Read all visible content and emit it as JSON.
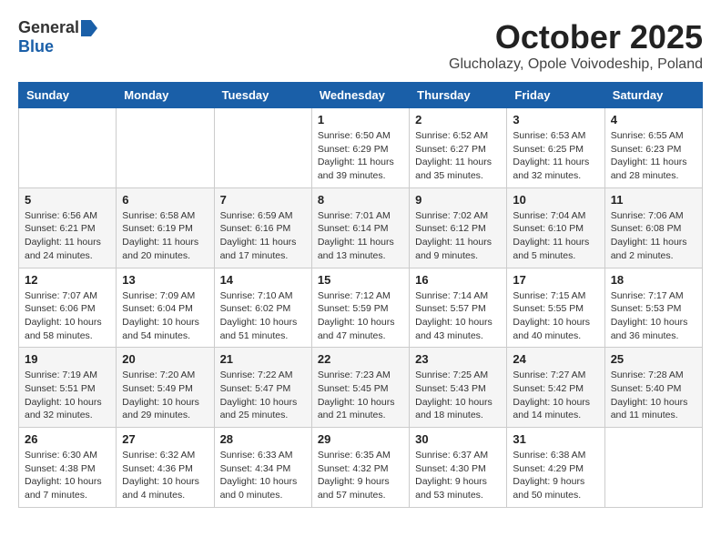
{
  "logo": {
    "general": "General",
    "blue": "Blue"
  },
  "title": {
    "month": "October 2025",
    "location": "Glucholazy, Opole Voivodeship, Poland"
  },
  "headers": [
    "Sunday",
    "Monday",
    "Tuesday",
    "Wednesday",
    "Thursday",
    "Friday",
    "Saturday"
  ],
  "weeks": [
    [
      {
        "day": "",
        "info": ""
      },
      {
        "day": "",
        "info": ""
      },
      {
        "day": "",
        "info": ""
      },
      {
        "day": "1",
        "info": "Sunrise: 6:50 AM\nSunset: 6:29 PM\nDaylight: 11 hours\nand 39 minutes."
      },
      {
        "day": "2",
        "info": "Sunrise: 6:52 AM\nSunset: 6:27 PM\nDaylight: 11 hours\nand 35 minutes."
      },
      {
        "day": "3",
        "info": "Sunrise: 6:53 AM\nSunset: 6:25 PM\nDaylight: 11 hours\nand 32 minutes."
      },
      {
        "day": "4",
        "info": "Sunrise: 6:55 AM\nSunset: 6:23 PM\nDaylight: 11 hours\nand 28 minutes."
      }
    ],
    [
      {
        "day": "5",
        "info": "Sunrise: 6:56 AM\nSunset: 6:21 PM\nDaylight: 11 hours\nand 24 minutes."
      },
      {
        "day": "6",
        "info": "Sunrise: 6:58 AM\nSunset: 6:19 PM\nDaylight: 11 hours\nand 20 minutes."
      },
      {
        "day": "7",
        "info": "Sunrise: 6:59 AM\nSunset: 6:16 PM\nDaylight: 11 hours\nand 17 minutes."
      },
      {
        "day": "8",
        "info": "Sunrise: 7:01 AM\nSunset: 6:14 PM\nDaylight: 11 hours\nand 13 minutes."
      },
      {
        "day": "9",
        "info": "Sunrise: 7:02 AM\nSunset: 6:12 PM\nDaylight: 11 hours\nand 9 minutes."
      },
      {
        "day": "10",
        "info": "Sunrise: 7:04 AM\nSunset: 6:10 PM\nDaylight: 11 hours\nand 5 minutes."
      },
      {
        "day": "11",
        "info": "Sunrise: 7:06 AM\nSunset: 6:08 PM\nDaylight: 11 hours\nand 2 minutes."
      }
    ],
    [
      {
        "day": "12",
        "info": "Sunrise: 7:07 AM\nSunset: 6:06 PM\nDaylight: 10 hours\nand 58 minutes."
      },
      {
        "day": "13",
        "info": "Sunrise: 7:09 AM\nSunset: 6:04 PM\nDaylight: 10 hours\nand 54 minutes."
      },
      {
        "day": "14",
        "info": "Sunrise: 7:10 AM\nSunset: 6:02 PM\nDaylight: 10 hours\nand 51 minutes."
      },
      {
        "day": "15",
        "info": "Sunrise: 7:12 AM\nSunset: 5:59 PM\nDaylight: 10 hours\nand 47 minutes."
      },
      {
        "day": "16",
        "info": "Sunrise: 7:14 AM\nSunset: 5:57 PM\nDaylight: 10 hours\nand 43 minutes."
      },
      {
        "day": "17",
        "info": "Sunrise: 7:15 AM\nSunset: 5:55 PM\nDaylight: 10 hours\nand 40 minutes."
      },
      {
        "day": "18",
        "info": "Sunrise: 7:17 AM\nSunset: 5:53 PM\nDaylight: 10 hours\nand 36 minutes."
      }
    ],
    [
      {
        "day": "19",
        "info": "Sunrise: 7:19 AM\nSunset: 5:51 PM\nDaylight: 10 hours\nand 32 minutes."
      },
      {
        "day": "20",
        "info": "Sunrise: 7:20 AM\nSunset: 5:49 PM\nDaylight: 10 hours\nand 29 minutes."
      },
      {
        "day": "21",
        "info": "Sunrise: 7:22 AM\nSunset: 5:47 PM\nDaylight: 10 hours\nand 25 minutes."
      },
      {
        "day": "22",
        "info": "Sunrise: 7:23 AM\nSunset: 5:45 PM\nDaylight: 10 hours\nand 21 minutes."
      },
      {
        "day": "23",
        "info": "Sunrise: 7:25 AM\nSunset: 5:43 PM\nDaylight: 10 hours\nand 18 minutes."
      },
      {
        "day": "24",
        "info": "Sunrise: 7:27 AM\nSunset: 5:42 PM\nDaylight: 10 hours\nand 14 minutes."
      },
      {
        "day": "25",
        "info": "Sunrise: 7:28 AM\nSunset: 5:40 PM\nDaylight: 10 hours\nand 11 minutes."
      }
    ],
    [
      {
        "day": "26",
        "info": "Sunrise: 6:30 AM\nSunset: 4:38 PM\nDaylight: 10 hours\nand 7 minutes."
      },
      {
        "day": "27",
        "info": "Sunrise: 6:32 AM\nSunset: 4:36 PM\nDaylight: 10 hours\nand 4 minutes."
      },
      {
        "day": "28",
        "info": "Sunrise: 6:33 AM\nSunset: 4:34 PM\nDaylight: 10 hours\nand 0 minutes."
      },
      {
        "day": "29",
        "info": "Sunrise: 6:35 AM\nSunset: 4:32 PM\nDaylight: 9 hours\nand 57 minutes."
      },
      {
        "day": "30",
        "info": "Sunrise: 6:37 AM\nSunset: 4:30 PM\nDaylight: 9 hours\nand 53 minutes."
      },
      {
        "day": "31",
        "info": "Sunrise: 6:38 AM\nSunset: 4:29 PM\nDaylight: 9 hours\nand 50 minutes."
      },
      {
        "day": "",
        "info": ""
      }
    ]
  ]
}
